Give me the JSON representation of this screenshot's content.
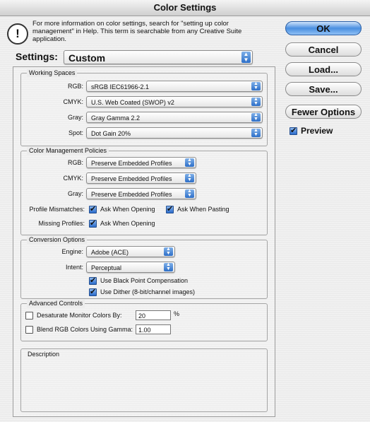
{
  "window": {
    "title": "Color Settings"
  },
  "info": {
    "text": "For more information on color settings, search for \"setting up color management\" in Help. This term is searchable from any Creative Suite application."
  },
  "settings": {
    "label": "Settings:",
    "value": "Custom"
  },
  "working_spaces": {
    "title": "Working Spaces",
    "rows": [
      {
        "label": "RGB:",
        "value": "sRGB IEC61966-2.1"
      },
      {
        "label": "CMYK:",
        "value": "U.S. Web Coated (SWOP) v2"
      },
      {
        "label": "Gray:",
        "value": "Gray Gamma 2.2"
      },
      {
        "label": "Spot:",
        "value": "Dot Gain 20%"
      }
    ]
  },
  "policies": {
    "title": "Color Management Policies",
    "rows": [
      {
        "label": "RGB:",
        "value": "Preserve Embedded Profiles"
      },
      {
        "label": "CMYK:",
        "value": "Preserve Embedded Profiles"
      },
      {
        "label": "Gray:",
        "value": "Preserve Embedded Profiles"
      }
    ],
    "mismatch_label": "Profile Mismatches:",
    "ask_opening": "Ask When Opening",
    "ask_pasting": "Ask When Pasting",
    "missing_label": "Missing Profiles:",
    "missing_ask_opening": "Ask When Opening"
  },
  "conversion": {
    "title": "Conversion Options",
    "engine_label": "Engine:",
    "engine_value": "Adobe (ACE)",
    "intent_label": "Intent:",
    "intent_value": "Perceptual",
    "bpc": "Use Black Point Compensation",
    "dither": "Use Dither (8-bit/channel images)"
  },
  "advanced": {
    "title": "Advanced Controls",
    "desaturate": "Desaturate Monitor Colors By:",
    "desaturate_value": "20",
    "desaturate_unit": "%",
    "blend": "Blend RGB Colors Using Gamma:",
    "blend_value": "1.00"
  },
  "description": {
    "title": "Description"
  },
  "buttons": {
    "ok": "OK",
    "cancel": "Cancel",
    "load": "Load...",
    "save": "Save...",
    "fewer": "Fewer Options",
    "preview": "Preview"
  }
}
